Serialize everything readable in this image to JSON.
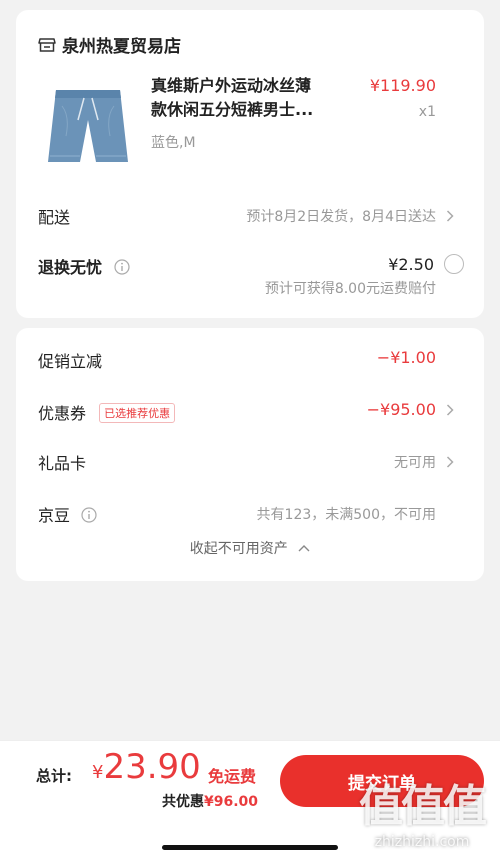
{
  "store": {
    "name": "泉州热夏贸易店",
    "icon": "store-icon"
  },
  "product": {
    "title_line1": "真维斯户外运动冰丝薄",
    "title_line2": "款休闲五分短裤男士...",
    "price": "¥119.90",
    "qty": "x1",
    "spec": "蓝色,M",
    "image": "denim-shorts-image"
  },
  "delivery": {
    "label": "配送",
    "value": "预计8月2日发货，8月4日送达"
  },
  "return_service": {
    "label": "退换无忧",
    "price": "¥2.50",
    "note": "预计可获得8.00元运费赔付"
  },
  "promo": {
    "label": "促销立减",
    "value": "−¥1.00"
  },
  "coupon": {
    "label": "优惠券",
    "tag": "已选推荐优惠",
    "value": "−¥95.00"
  },
  "giftcard": {
    "label": "礼品卡",
    "value": "无可用"
  },
  "jingdou": {
    "label": "京豆",
    "value": "共有123，未满500，不可用"
  },
  "collapse_text": "收起不可用资产",
  "footer": {
    "total_label": "总计:",
    "currency": "¥",
    "total": "23.90",
    "free_shipping": "免运费",
    "discount_label": "共优惠",
    "discount_value": "¥96.00",
    "submit": "提交订单"
  },
  "watermark": {
    "glyph": "值值值",
    "text": "zhizhizhi.com"
  },
  "colors": {
    "accent": "#e93b3d",
    "button": "#e9302c",
    "background": "#f2f2f2"
  }
}
